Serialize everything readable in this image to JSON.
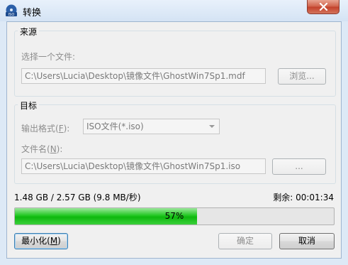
{
  "window": {
    "title": "转换",
    "icon": "iso-disc-icon",
    "close_icon": "close-icon"
  },
  "source": {
    "group_title": "来源",
    "file_label": "选择一个文件:",
    "file_path": "C:\\Users\\Lucia\\Desktop\\镜像文件\\GhostWin7Sp1.mdf",
    "browse_label": "浏览..."
  },
  "target": {
    "group_title": "目标",
    "format_label": "输出格式(",
    "format_key": "F",
    "format_label_end": "):",
    "format_value": "ISO文件(*.iso)",
    "filename_label": "文件名(",
    "filename_key": "N",
    "filename_label_end": "):",
    "file_path": "C:\\Users\\Lucia\\Desktop\\镜像文件\\GhostWin7Sp1.iso",
    "browse_label": "..."
  },
  "progress": {
    "size_text": "1.48 GB / 2.57 GB (9.8 MB/秒)",
    "remaining_text": "剩余: 00:01:34",
    "percent": 57,
    "percent_text": "57%"
  },
  "buttons": {
    "minimize_label": "最小化(",
    "minimize_key": "M",
    "minimize_label_end": ")",
    "ok_label": "确定",
    "cancel_label": "取消"
  },
  "colors": {
    "progress": "#22c722",
    "close": "#c3412a"
  }
}
